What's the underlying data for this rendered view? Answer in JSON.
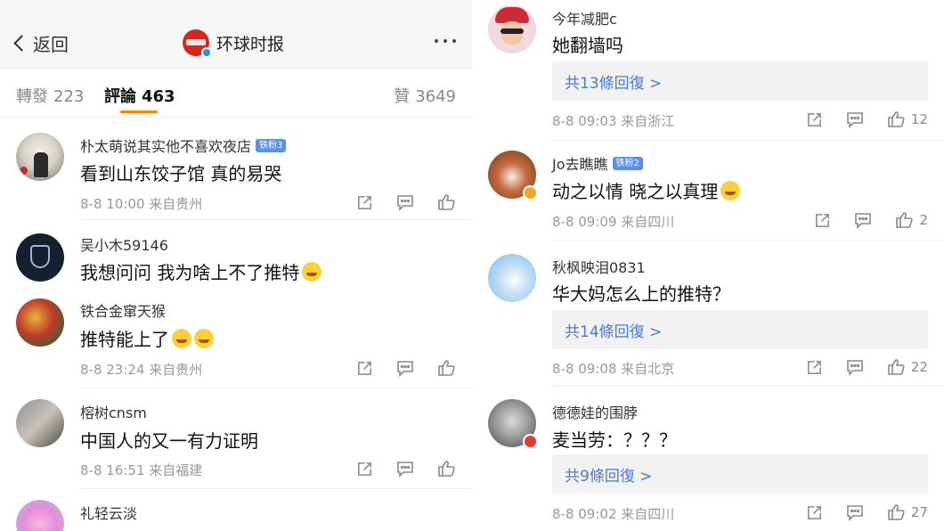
{
  "header": {
    "back_label": "返回",
    "account_name": "环球时报",
    "brand_color": "#d9261c",
    "verified_color": "#2f8be8"
  },
  "tabs": {
    "repost": {
      "label": "轉發",
      "count": "223"
    },
    "comments": {
      "label": "評論",
      "count": "463"
    },
    "likes": {
      "label": "贊",
      "count": "3649"
    },
    "accent": "#ff8200"
  },
  "left_comments": [
    {
      "user": "朴太萌说其实他不喜欢夜店",
      "fan_badge": "铁粉3",
      "text": "看到山东饺子馆 真的易哭",
      "emoji": "",
      "meta": "8-8 10:00 来自贵州",
      "likes": ""
    },
    {
      "user": "吴小木59146",
      "fan_badge": "",
      "text": "我想问问 我为啥上不了推特",
      "emoji": "shy-face",
      "meta": "",
      "likes": ""
    },
    {
      "user": "铁合金窜天猴",
      "fan_badge": "",
      "text": "推特能上了",
      "emoji": "laugh-cry x2",
      "meta": "8-8 23:24 来自贵州",
      "likes": ""
    },
    {
      "user": "榕树cnsm",
      "fan_badge": "",
      "text": "中国人的又一有力证明",
      "emoji": "",
      "meta": "8-8 16:51 来自福建",
      "likes": ""
    },
    {
      "user": "礼轻云淡",
      "fan_badge": "",
      "text": "",
      "emoji": "",
      "meta": "",
      "likes": ""
    }
  ],
  "right_comments": [
    {
      "user": "今年减肥c",
      "fan_badge": "",
      "text": "她翻墙吗",
      "replies": "共13條回復 >",
      "meta": "8-8 09:03 来自浙江",
      "likes": "12"
    },
    {
      "user": "Jo去瞧瞧",
      "fan_badge": "铁粉2",
      "text": "动之以情 晓之以真理",
      "replies": "",
      "meta": "8-8 09:09 来自四川",
      "likes": "2"
    },
    {
      "user": "秋枫映泪0831",
      "fan_badge": "",
      "text": "华大妈怎么上的推特？",
      "replies": "共14條回復 >",
      "meta": "8-8 09:08 来自北京",
      "likes": "22"
    },
    {
      "user": "德德娃的围脖",
      "fan_badge": "",
      "text": "麦当劳：？？？",
      "replies": "共9條回復 >",
      "meta": "8-8 09:02 来自四川",
      "likes": "27"
    }
  ],
  "icons": [
    "back-chevron-icon",
    "more-dots-icon",
    "share-icon",
    "comment-icon",
    "like-icon",
    "verified-icon"
  ]
}
